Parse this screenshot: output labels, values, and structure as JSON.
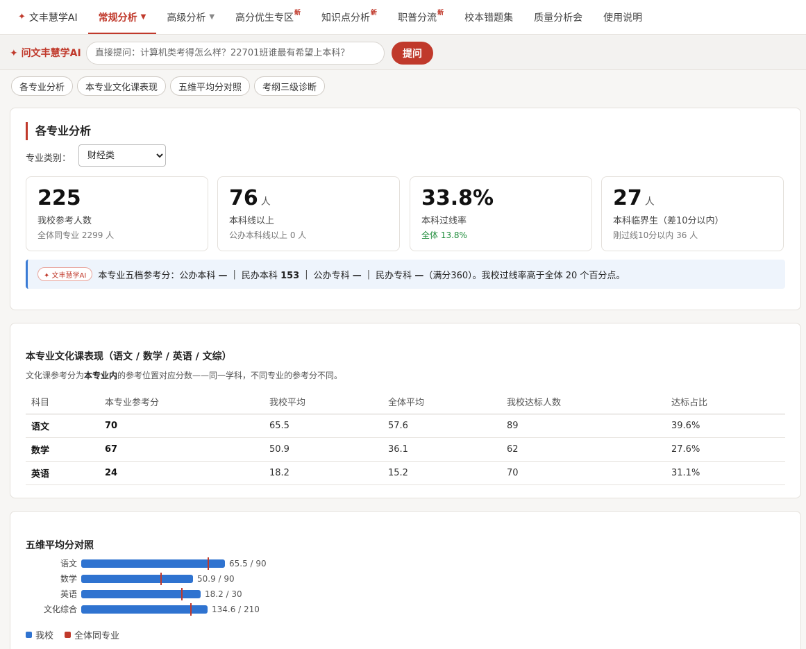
{
  "nav": {
    "brand": "文丰慧学AI",
    "items": [
      {
        "label": "常规分析",
        "caret": true,
        "new": false,
        "active": true
      },
      {
        "label": "高级分析",
        "caret": true,
        "new": false,
        "active": false
      },
      {
        "label": "高分优生专区",
        "caret": false,
        "new": true,
        "active": false
      },
      {
        "label": "知识点分析",
        "caret": false,
        "new": true,
        "active": false
      },
      {
        "label": "职普分流",
        "caret": false,
        "new": true,
        "active": false
      },
      {
        "label": "校本错题集",
        "caret": false,
        "new": false,
        "active": false
      },
      {
        "label": "质量分析会",
        "caret": false,
        "new": false,
        "active": false
      },
      {
        "label": "使用说明",
        "caret": false,
        "new": false,
        "active": false
      }
    ],
    "new_badge": "新"
  },
  "ask": {
    "label": "问文丰慧学AI",
    "placeholder": "直接提问：计算机类考得怎么样？22701班谁最有希望上本科？",
    "button": "提问"
  },
  "tabs": [
    "各专业分析",
    "本专业文化课表现",
    "五维平均分对照",
    "考纲三级诊断"
  ],
  "major_analysis": {
    "title": "各专业分析",
    "category_label": "专业类别：",
    "category_value": "财经类",
    "stats": [
      {
        "value": "225",
        "unit": "",
        "label": "我校参考人数",
        "sub": "全体同专业 2299 人",
        "sub_color": "gray"
      },
      {
        "value": "76",
        "unit": "人",
        "label": "本科线以上",
        "sub": "公办本科线以上 0 人",
        "sub_color": "gray"
      },
      {
        "value": "33.8%",
        "unit": "",
        "label": "本科过线率",
        "sub": "全体 13.8%",
        "sub_color": "green"
      },
      {
        "value": "27",
        "unit": "人",
        "label": "本科临界生（差10分以内）",
        "sub": "刚过线10分以内 36 人",
        "sub_color": "gray"
      }
    ],
    "ai_note": {
      "badge": "✦ 文丰慧学AI",
      "prefix": "本专业五档参考分：",
      "items": [
        {
          "name": "公办本科",
          "value": "—"
        },
        {
          "name": "民办本科",
          "value": "153"
        },
        {
          "name": "公办专科",
          "value": "—"
        },
        {
          "name": "民办专科",
          "value": "—"
        }
      ],
      "suffix": "（满分360）。我校过线率高于全体 20 个百分点。",
      "separator": "|"
    }
  },
  "culture": {
    "title": "本专业文化课表现（语文 / 数学 / 英语 / 文综）",
    "desc_pre": "文化课参考分为",
    "desc_bold": "本专业内",
    "desc_post": "的参考位置对应分数——同一学科，不同专业的参考分不同。",
    "headers": [
      "科目",
      "本专业参考分",
      "我校平均",
      "全体平均",
      "我校达标人数",
      "达标占比"
    ],
    "rows": [
      [
        "语文",
        "70",
        "65.5",
        "57.6",
        "89",
        "39.6%"
      ],
      [
        "数学",
        "67",
        "50.9",
        "36.1",
        "62",
        "27.6%"
      ],
      [
        "英语",
        "24",
        "18.2",
        "15.2",
        "70",
        "31.1%"
      ]
    ]
  },
  "five_dim": {
    "title": "五维平均分对照",
    "legend": [
      {
        "label": "我校",
        "color": "#2f73d0"
      },
      {
        "label": "全体同专业",
        "color": "#c0392b"
      }
    ]
  },
  "chart_data": {
    "type": "bar",
    "categories": [
      "语文",
      "数学",
      "英语",
      "文化综合"
    ],
    "series": [
      {
        "name": "我校",
        "values": [
          65.5,
          50.9,
          18.2,
          134.6
        ]
      },
      {
        "name": "全体同专业",
        "values": [
          57.6,
          36.1,
          15.2,
          116
        ]
      }
    ],
    "max": [
      90,
      90,
      30,
      210
    ],
    "value_labels": [
      "65.5 / 90",
      "50.9 / 90",
      "18.2 / 30",
      "134.6 / 210"
    ],
    "orientation": "horizontal",
    "colors": {
      "我校": "#2f73d0",
      "全体同专业": "#c0392b"
    }
  }
}
